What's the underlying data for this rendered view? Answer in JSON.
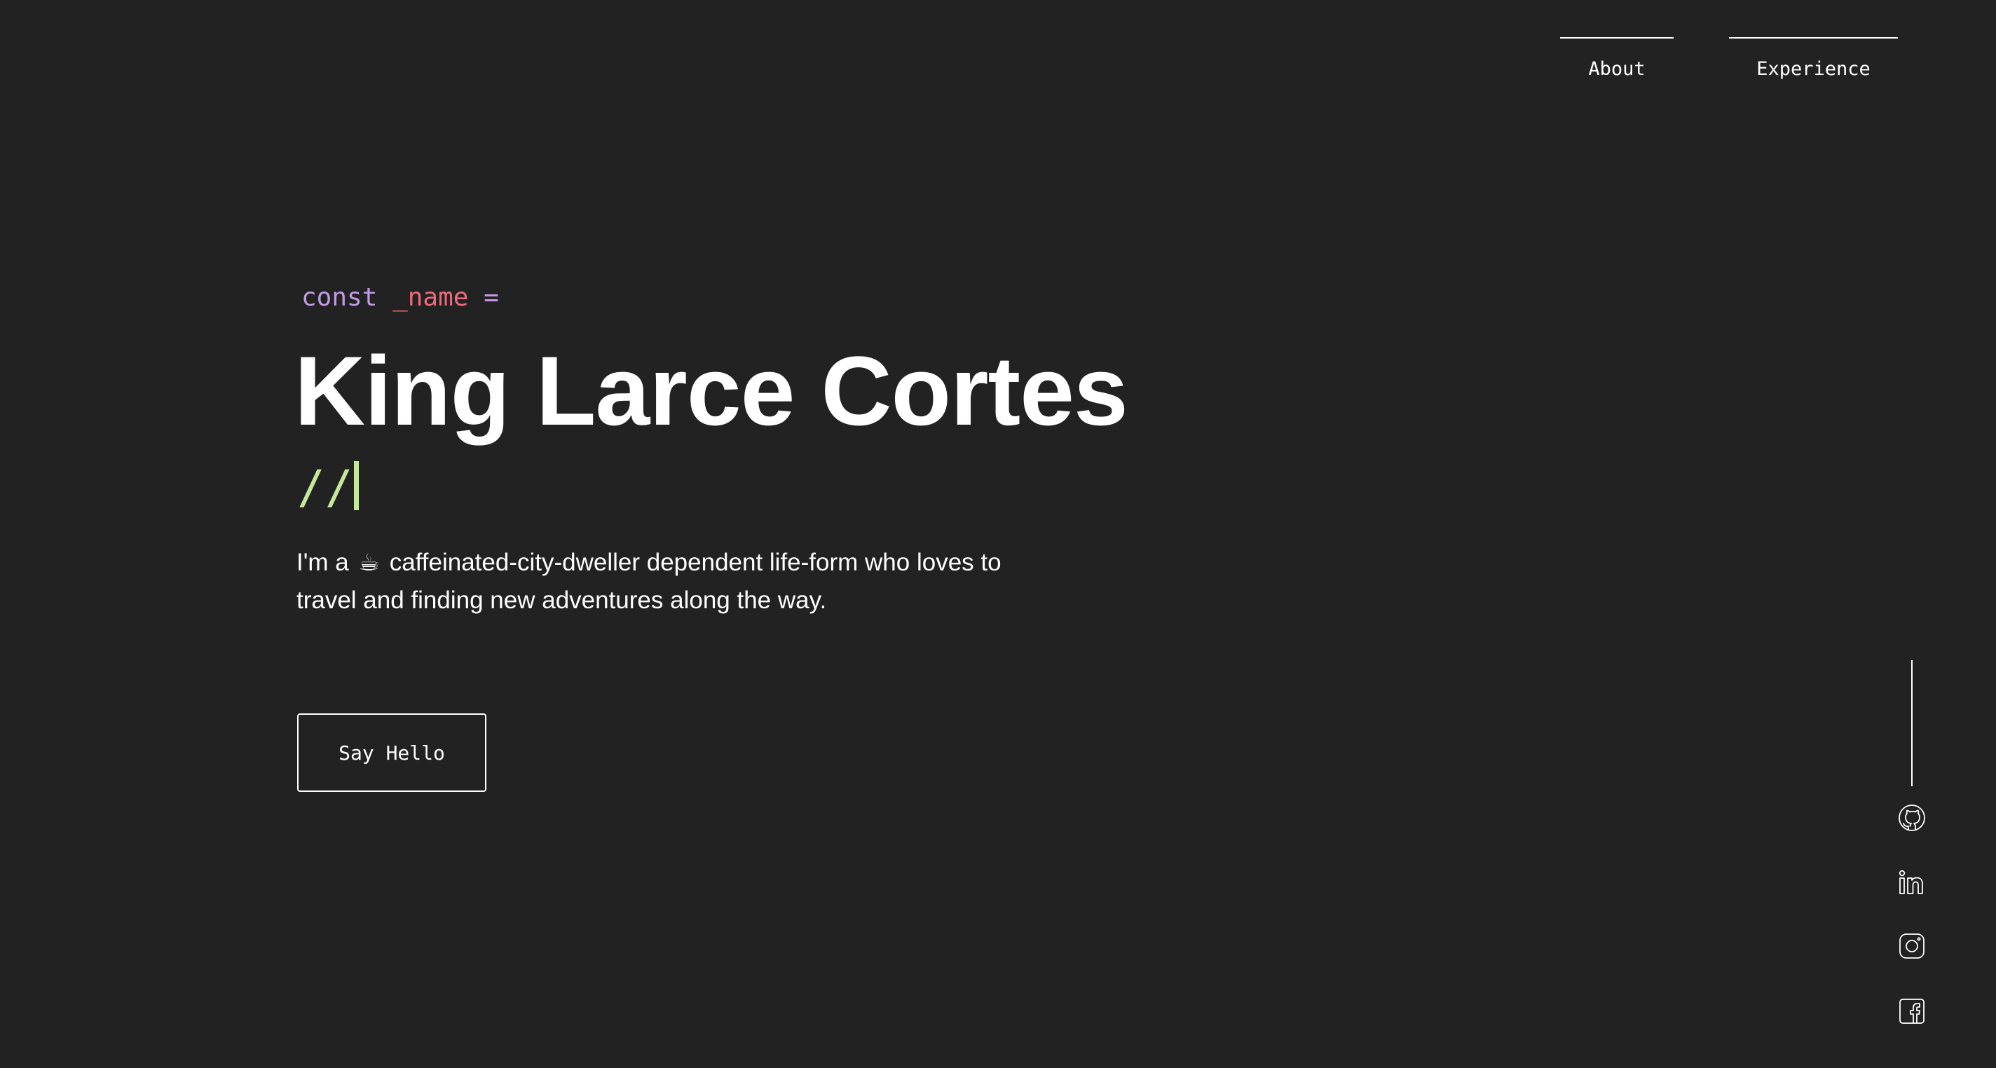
{
  "nav": {
    "items": [
      {
        "label": "About"
      },
      {
        "label": "Experience"
      }
    ]
  },
  "hero": {
    "code": {
      "keyword": "const",
      "variable": "_name",
      "operator": "="
    },
    "name": "King Larce Cortes",
    "comment": "//",
    "intro": {
      "before_emoji": "I'm a",
      "emoji": "☕",
      "after_emoji": "caffeinated-city-dweller dependent life-form who loves to travel and finding new adventures along the way."
    },
    "cta_label": "Say Hello"
  },
  "social": {
    "icons": [
      "github-icon",
      "linkedin-icon",
      "instagram-icon",
      "facebook-icon"
    ]
  },
  "colors": {
    "background": "#222222",
    "text": "#ffffff",
    "keyword": "#c29ae6",
    "variable": "#ef6a7a",
    "comment": "#c6e89a"
  }
}
